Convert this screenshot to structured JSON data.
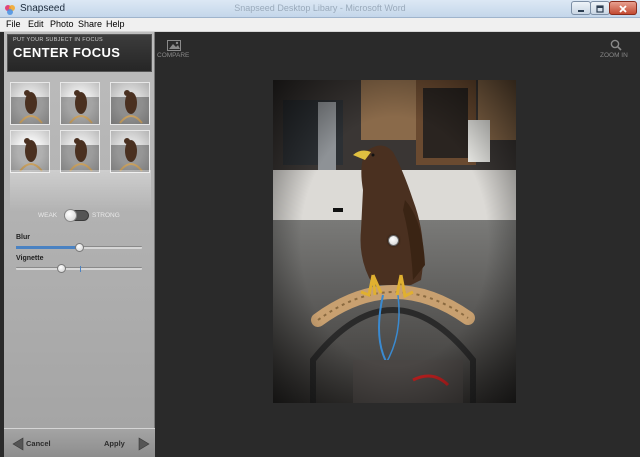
{
  "window": {
    "title": "Snapseed",
    "ghost_title": "Snapseed Desktop Libary - Microsoft Word"
  },
  "menu": [
    "File",
    "Edit",
    "Photo",
    "Share",
    "Help"
  ],
  "tool": {
    "subtitle": "PUT YOUR SUBJECT IN FOCUS",
    "title": "CENTER FOCUS"
  },
  "toggle": {
    "weak_label": "WEAK",
    "strong_label": "STRONG",
    "state": "weak"
  },
  "sliders": [
    {
      "label": "Blur",
      "value": 0.5
    },
    {
      "label": "Vignette",
      "value": 0.36
    }
  ],
  "footer": {
    "cancel_label": "Cancel",
    "apply_label": "Apply"
  },
  "toolbar": {
    "compare_label": "COMPARE",
    "zoom_label": "ZOOM IN"
  },
  "icons": [
    "snapseed-app-icon",
    "minimize-icon",
    "maximize-icon",
    "close-icon",
    "compare-icon",
    "magnifier-icon",
    "arrow-left-icon",
    "arrow-right-icon"
  ],
  "colors": {
    "accent": "#4a82c2",
    "sidebar": "#b0b0b0",
    "canvas": "#2a2a2a"
  }
}
